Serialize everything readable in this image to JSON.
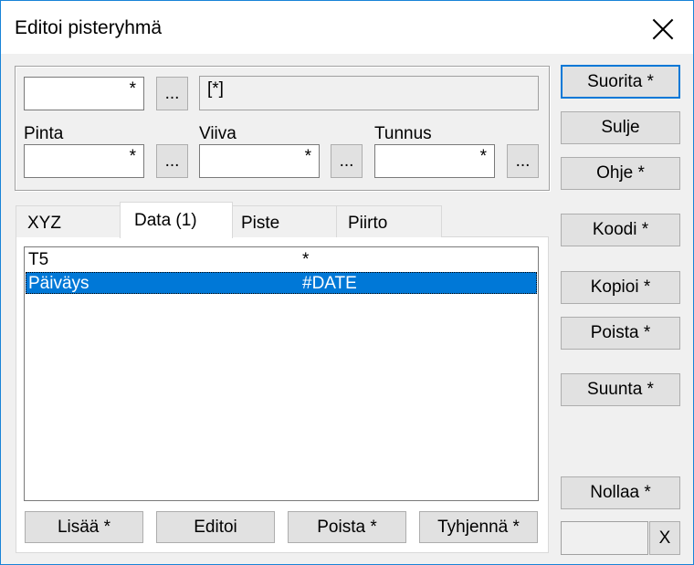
{
  "window": {
    "title": "Editoi pisteryhmä"
  },
  "top_group": {
    "field1_value": "*",
    "browse_label": "...",
    "readonly_value": "[*]",
    "pinta_label": "Pinta",
    "pinta_value": "*",
    "viiva_label": "Viiva",
    "viiva_value": "*",
    "tunnus_label": "Tunnus",
    "tunnus_value": "*"
  },
  "tabs": [
    {
      "label": "XYZ"
    },
    {
      "label": "Data (1)"
    },
    {
      "label": "Piste"
    },
    {
      "label": "Piirto"
    }
  ],
  "list": {
    "rows": [
      {
        "name": "T5",
        "value": "*"
      },
      {
        "name": "Päiväys",
        "value": "#DATE"
      }
    ]
  },
  "list_buttons": {
    "add": "Lisää *",
    "edit": "Editoi",
    "delete": "Poista *",
    "clear": "Tyhjennä *"
  },
  "side_buttons": {
    "run": "Suorita *",
    "close": "Sulje",
    "help": "Ohje *",
    "code": "Koodi *",
    "copy": "Kopioi *",
    "delete": "Poista *",
    "direction": "Suunta *",
    "reset": "Nollaa *"
  },
  "bottom": {
    "x_label": "X"
  },
  "colors": {
    "accent": "#0078d7",
    "border": "#1883d7"
  }
}
